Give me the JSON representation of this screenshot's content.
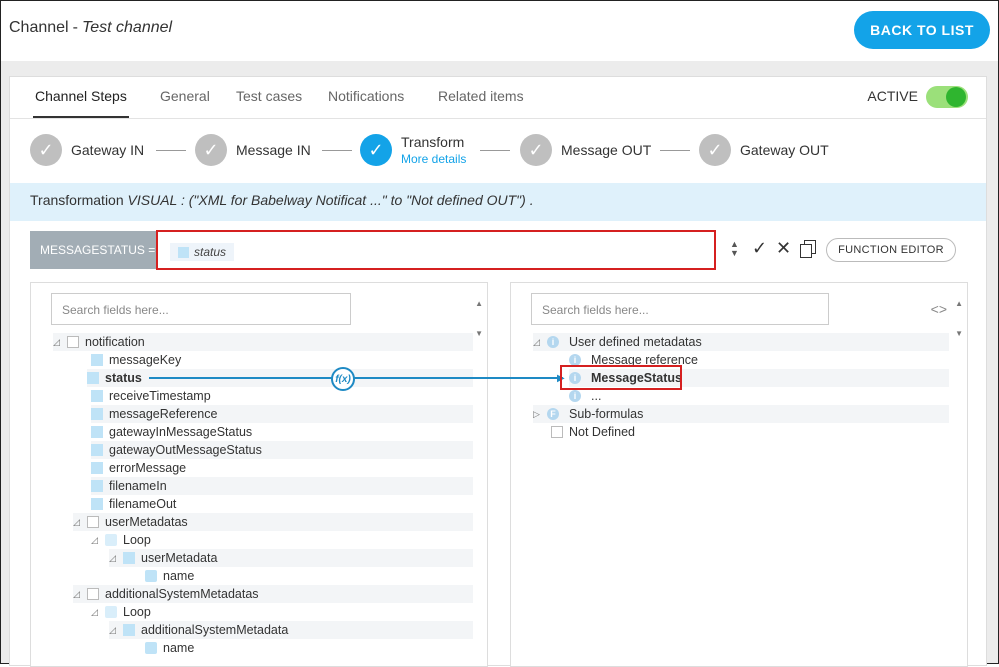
{
  "header": {
    "title": "Channel",
    "separator": "-",
    "channel_name": "Test channel",
    "back_label": "BACK TO LIST"
  },
  "tabs": [
    {
      "label": "Channel Steps"
    },
    {
      "label": "General"
    },
    {
      "label": "Test cases"
    },
    {
      "label": "Notifications"
    },
    {
      "label": "Related items"
    }
  ],
  "status": {
    "label": "ACTIVE",
    "on": true
  },
  "steps": [
    {
      "label": "Gateway IN"
    },
    {
      "label": "Message IN"
    },
    {
      "label": "Transform",
      "sublabel": "More details"
    },
    {
      "label": "Message OUT"
    },
    {
      "label": "Gateway OUT"
    }
  ],
  "info": {
    "prefix": "Transformation",
    "detail": "VISUAL : (\"XML for Babelway Notificat ...\" to \"Not defined OUT\") ."
  },
  "formula": {
    "label": "MESSAGESTATUS =",
    "chip": "status",
    "function_editor": "FUNCTION EDITOR"
  },
  "left_panel": {
    "search_placeholder": "Search fields here...",
    "rows": [
      "notification",
      "messageKey",
      "status",
      "receiveTimestamp",
      "messageReference",
      "gatewayInMessageStatus",
      "gatewayOutMessageStatus",
      "errorMessage",
      "filenameIn",
      "filenameOut",
      "userMetadatas",
      "Loop",
      "userMetadata",
      "name",
      "additionalSystemMetadatas",
      "Loop",
      "additionalSystemMetadata",
      "name"
    ]
  },
  "right_panel": {
    "search_placeholder": "Search fields here...",
    "rows": [
      "User defined metadatas",
      "Message reference",
      "MessageStatus",
      "...",
      "Sub-formulas",
      "Not Defined"
    ]
  },
  "mapping": {
    "fx_label": "f(x)"
  },
  "colors": {
    "accent": "#13a3e8",
    "highlight": "#d52020",
    "toggle": "#2fb52f"
  }
}
